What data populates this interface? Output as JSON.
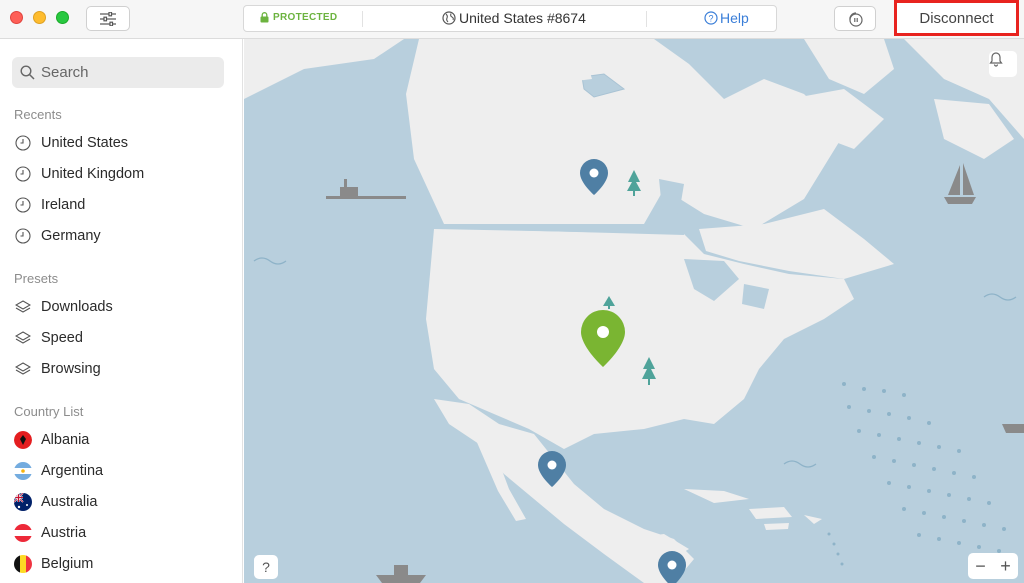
{
  "header": {
    "status_label": "PROTECTED",
    "server_label": "United States #8674",
    "help_label": "Help",
    "disconnect_label": "Disconnect"
  },
  "sidebar": {
    "search_placeholder": "Search",
    "recents_title": "Recents",
    "recents": [
      {
        "label": "United States"
      },
      {
        "label": "United Kingdom"
      },
      {
        "label": "Ireland"
      },
      {
        "label": "Germany"
      }
    ],
    "presets_title": "Presets",
    "presets": [
      {
        "label": "Downloads"
      },
      {
        "label": "Speed"
      },
      {
        "label": "Browsing"
      }
    ],
    "countries_title": "Country List",
    "countries": [
      {
        "label": "Albania"
      },
      {
        "label": "Argentina"
      },
      {
        "label": "Australia"
      },
      {
        "label": "Austria"
      },
      {
        "label": "Belgium"
      }
    ]
  },
  "map": {
    "help_label": "?",
    "zoom_out_label": "−",
    "zoom_in_label": "+"
  },
  "colors": {
    "accent_green": "#6cb33f",
    "pin_blue": "#4f7fa4",
    "water": "#b8cfdd",
    "land": "#eeeeee",
    "highlight_red": "#e8231f"
  }
}
